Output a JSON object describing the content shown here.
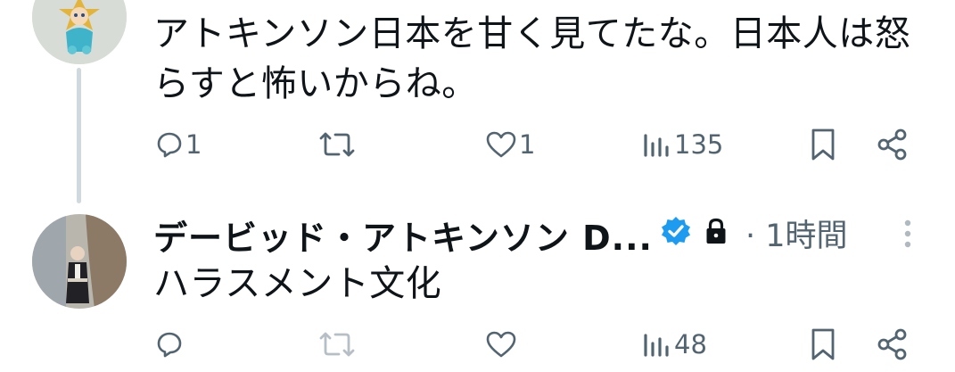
{
  "tweet1": {
    "text_line1": "アトキンソン日本を甘く見てたな。日本人は怒",
    "text_line2": "らすと怖いからね。",
    "replies": "1",
    "reposts": "",
    "likes": "1",
    "views": "135"
  },
  "tweet2": {
    "author_name": "デービッド・アトキンソン D...",
    "verified_icon": "verified-badge-icon",
    "protected_icon": "lock-icon",
    "time": "· 1時間",
    "text": "ハラスメント文化",
    "replies": "",
    "reposts": "",
    "likes": "",
    "views": "48"
  },
  "colors": {
    "verified": "#1d9bf0",
    "muted": "#536471",
    "thread_line": "#cfd9de",
    "text": "#0f1419"
  }
}
